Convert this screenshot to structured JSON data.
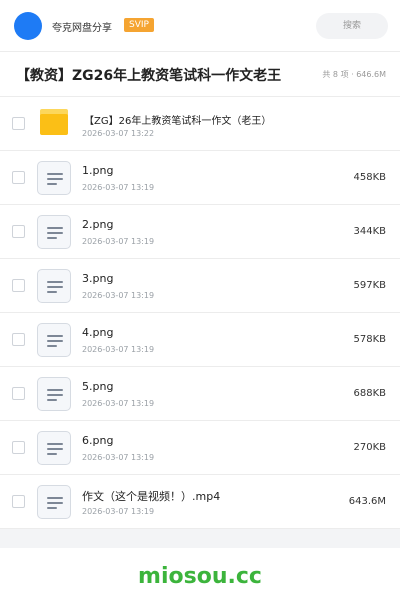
{
  "header": {
    "share_name": "夸克网盘分享",
    "badge": "SVIP",
    "search_placeholder": "搜索",
    "avatar_color": "#1e7bf5"
  },
  "folder": {
    "title": "【教资】ZG26年上教资笔试科一作文老王",
    "stats": "共 8 项 · 646.6M"
  },
  "items": [
    {
      "type": "folder",
      "icon": "folder-icon",
      "name": "【ZG】26年上教资笔试科一作文（老王）",
      "date": "2026-03-07 13:22",
      "size": ""
    },
    {
      "type": "file",
      "icon": "file-icon",
      "name": "1.png",
      "date": "2026-03-07 13:19",
      "size": "458KB"
    },
    {
      "type": "file",
      "icon": "file-icon",
      "name": "2.png",
      "date": "2026-03-07 13:19",
      "size": "344KB"
    },
    {
      "type": "file",
      "icon": "file-icon",
      "name": "3.png",
      "date": "2026-03-07 13:19",
      "size": "597KB"
    },
    {
      "type": "file",
      "icon": "file-icon",
      "name": "4.png",
      "date": "2026-03-07 13:19",
      "size": "578KB"
    },
    {
      "type": "file",
      "icon": "file-icon",
      "name": "5.png",
      "date": "2026-03-07 13:19",
      "size": "688KB"
    },
    {
      "type": "file",
      "icon": "file-icon",
      "name": "6.png",
      "date": "2026-03-07 13:19",
      "size": "270KB"
    },
    {
      "type": "file",
      "icon": "file-icon",
      "name": "作文（这个是视频！）.mp4",
      "date": "2026-03-07 13:19",
      "size": "643.6M"
    }
  ],
  "footer": {
    "watermark": "miosou.cc",
    "watermark_color": "#3cb43c"
  }
}
